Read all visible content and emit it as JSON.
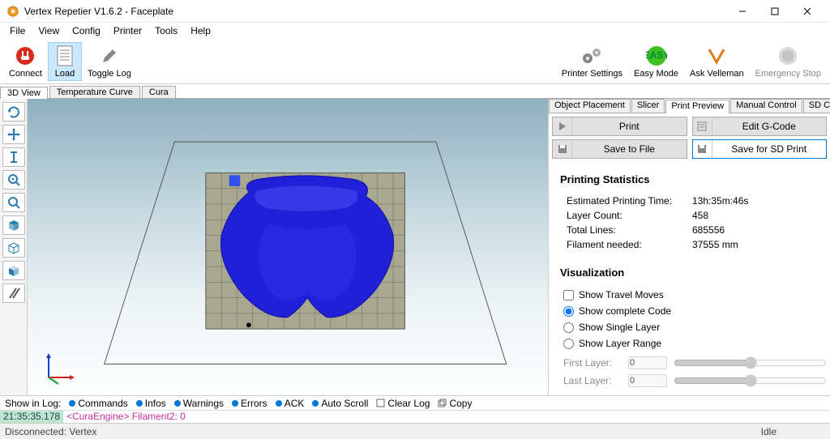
{
  "window": {
    "title": "Vertex Repetier V1.6.2 - Faceplate"
  },
  "menu": {
    "file": "File",
    "view": "View",
    "config": "Config",
    "printer": "Printer",
    "tools": "Tools",
    "help": "Help"
  },
  "toolbar": {
    "connect": "Connect",
    "load": "Load",
    "toggle_log": "Toggle Log",
    "printer_settings": "Printer Settings",
    "easy_mode": "Easy Mode",
    "ask_velleman": "Ask Velleman",
    "emergency_stop": "Emergency Stop"
  },
  "left_tabs": {
    "t3d": "3D View",
    "temp": "Temperature Curve",
    "cura": "Cura"
  },
  "right_tabs": {
    "placement": "Object Placement",
    "slicer": "Slicer",
    "preview": "Print Preview",
    "manual": "Manual Control",
    "sd": "SD Card"
  },
  "preview": {
    "print": "Print",
    "edit_gcode": "Edit G-Code",
    "save_file": "Save to File",
    "save_sd": "Save for SD Print",
    "stats_title": "Printing Statistics",
    "stats": {
      "time_k": "Estimated Printing Time:",
      "time_v": "13h:35m:46s",
      "layers_k": "Layer Count:",
      "layers_v": "458",
      "lines_k": "Total Lines:",
      "lines_v": "685556",
      "filament_k": "Filament needed:",
      "filament_v": "37555 mm"
    },
    "viz_title": "Visualization",
    "viz": {
      "travel": "Show Travel Moves",
      "complete": "Show complete Code",
      "single": "Show Single Layer",
      "range": "Show Layer Range",
      "first": "First Layer:",
      "last": "Last Layer:",
      "zero": "0"
    }
  },
  "logbar": {
    "showin": "Show in Log:",
    "commands": "Commands",
    "infos": "Infos",
    "warnings": "Warnings",
    "errors": "Errors",
    "ack": "ACK",
    "autoscroll": "Auto Scroll",
    "clear": "Clear Log",
    "copy": "Copy"
  },
  "console": {
    "ts": "21:35:35.178",
    "line": "<CuraEngine> Filament2: 0"
  },
  "status": {
    "left": "Disconnected: Vertex",
    "right": "Idle"
  }
}
